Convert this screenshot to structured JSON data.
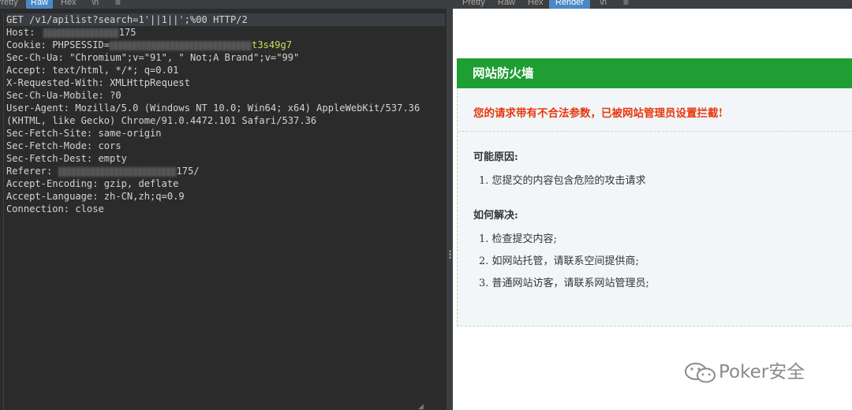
{
  "request_panel": {
    "tabs": [
      "Pretty",
      "Raw",
      "Hex",
      "\\n",
      "≡"
    ],
    "active_tab": "Raw",
    "lines": [
      {
        "key": "GET /v1/apilist?search=1'||1||';%00 HTTP/2",
        "value": ""
      },
      {
        "key": "Host: ",
        "value": "175",
        "redacted_before_value": true
      },
      {
        "key": "Cookie: PHPSESSID=",
        "value": "t3s49g7",
        "redacted_before_value": true
      },
      {
        "key": "Sec-Ch-Ua: ",
        "value": "\"Chromium\";v=\"91\", \" Not;A Brand\";v=\"99\""
      },
      {
        "key": "Accept: ",
        "value": "text/html, */*; q=0.01"
      },
      {
        "key": "X-Requested-With: ",
        "value": "XMLHttpRequest"
      },
      {
        "key": "Sec-Ch-Ua-Mobile: ",
        "value": "?0"
      },
      {
        "key": "User-Agent: ",
        "value": "Mozilla/5.0 (Windows NT 10.0; Win64; x64) AppleWebKit/537.36"
      },
      {
        "key": "",
        "value": "(KHTML, like Gecko) Chrome/91.0.4472.101 Safari/537.36"
      },
      {
        "key": "Sec-Fetch-Site: ",
        "value": "same-origin"
      },
      {
        "key": "Sec-Fetch-Mode: ",
        "value": "cors"
      },
      {
        "key": "Sec-Fetch-Dest: ",
        "value": "empty"
      },
      {
        "key": "Referer: ",
        "value": "175/",
        "redacted_before_value": true
      },
      {
        "key": "Accept-Encoding: ",
        "value": "gzip, deflate"
      },
      {
        "key": "Accept-Language: ",
        "value": "zh-CN,zh;q=0.9"
      },
      {
        "key": "Connection: ",
        "value": "close"
      }
    ]
  },
  "response_panel": {
    "tabs": [
      "Pretty",
      "Raw",
      "Hex",
      "Render",
      "\\n",
      "≡"
    ],
    "active_tab": "Render",
    "waf": {
      "title": "网站防火墙",
      "alert": "您的请求带有不合法参数，已被网站管理员设置拦截!",
      "reasons_heading": "可能原因:",
      "reasons": [
        "1. 您提交的内容包含危险的攻击请求"
      ],
      "solutions_heading": "如何解决:",
      "solutions": [
        "1. 检查提交内容;",
        "2. 如网站托管，请联系空间提供商;",
        "3. 普通网站访客，请联系网站管理员;"
      ]
    },
    "colors": {
      "header": "#1e9e33",
      "alert": "#e8370d",
      "box": "#f3f6f8"
    }
  },
  "watermark": {
    "icon": "wechat-icon",
    "text": "Poker安全"
  }
}
